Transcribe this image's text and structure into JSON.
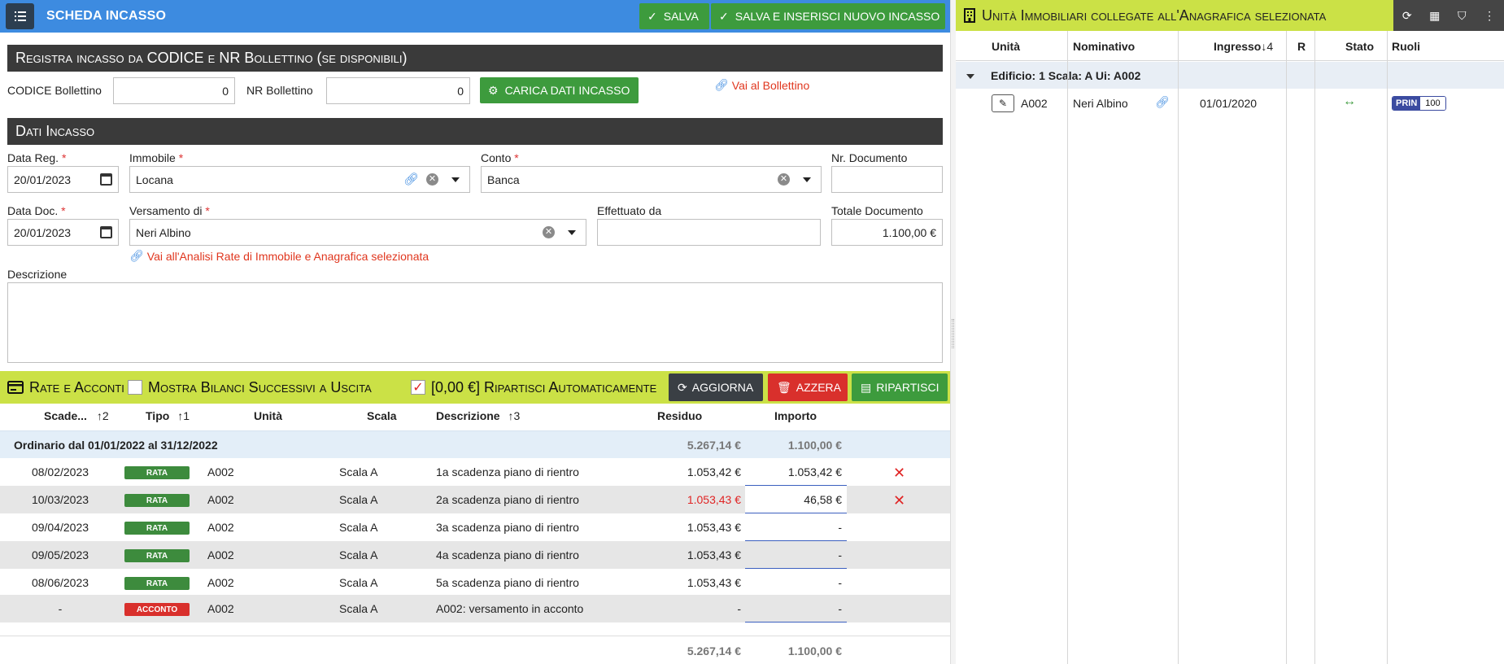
{
  "header": {
    "title": "SCHEDA INCASSO",
    "save_label": "SALVA",
    "save_new_label": "SALVA E INSERISCI NUOVO INCASSO"
  },
  "bollettino": {
    "section_title": "Registra incasso da CODICE e NR Bollettino (se disponibili)",
    "codice_label": "CODICE Bollettino",
    "codice_value": "0",
    "nr_label": "NR Bollettino",
    "nr_value": "0",
    "load_label": "CARICA DATI INCASSO",
    "link_label": "Vai al Bollettino"
  },
  "dati": {
    "section_title": "Dati Incasso",
    "data_reg_label": "Data Reg.",
    "data_reg_value": "20/01/2023",
    "immobile_label": "Immobile",
    "immobile_value": "Locana",
    "conto_label": "Conto",
    "conto_value": "Banca",
    "nr_doc_label": "Nr. Documento",
    "nr_doc_value": "",
    "data_doc_label": "Data Doc.",
    "data_doc_value": "20/01/2023",
    "versamento_label": "Versamento di",
    "versamento_value": "Neri Albino",
    "effettuato_label": "Effettuato da",
    "effettuato_value": "",
    "totale_label": "Totale Documento",
    "totale_value": "1.100,00 €",
    "analisi_link": "Vai all'Analisi Rate di Immobile e Anagrafica selezionata",
    "descrizione_label": "Descrizione",
    "descrizione_value": "",
    "required_mark": "*"
  },
  "rate": {
    "title": "Rate e Acconti",
    "mostra_label": "Mostra Bilanci Successivi a Uscita",
    "ripartisci_auto_label": "[0,00 €] Ripartisci Automaticamente",
    "aggiorna_label": "AGGIORNA",
    "azzera_label": "AZZERA",
    "ripartisci_label": "RIPARTISCI",
    "columns": {
      "scadenza": "Scade...",
      "scadenza_sort": "↑2",
      "tipo": "Tipo",
      "tipo_sort": "↑1",
      "unita": "Unità",
      "scala": "Scala",
      "descrizione": "Descrizione",
      "descrizione_sort": "↑3",
      "residuo": "Residuo",
      "importo": "Importo"
    },
    "group": {
      "label": "Ordinario dal 01/01/2022 al 31/12/2022",
      "residuo": "5.267,14 €",
      "importo": "1.100,00 €"
    },
    "rows": [
      {
        "scadenza": "08/02/2023",
        "tipo": "RATA",
        "unita": "A002",
        "scala": "Scala A",
        "descrizione": "1a scadenza piano di rientro",
        "residuo": "1.053,42 €",
        "importo": "1.053,42 €"
      },
      {
        "scadenza": "10/03/2023",
        "tipo": "RATA",
        "unita": "A002",
        "scala": "Scala A",
        "descrizione": "2a scadenza piano di rientro",
        "residuo": "1.053,43 €",
        "importo": "46,58 €"
      },
      {
        "scadenza": "09/04/2023",
        "tipo": "RATA",
        "unita": "A002",
        "scala": "Scala A",
        "descrizione": "3a scadenza piano di rientro",
        "residuo": "1.053,43 €",
        "importo": "-"
      },
      {
        "scadenza": "09/05/2023",
        "tipo": "RATA",
        "unita": "A002",
        "scala": "Scala A",
        "descrizione": "4a scadenza piano di rientro",
        "residuo": "1.053,43 €",
        "importo": "-"
      },
      {
        "scadenza": "08/06/2023",
        "tipo": "RATA",
        "unita": "A002",
        "scala": "Scala A",
        "descrizione": "5a scadenza piano di rientro",
        "residuo": "1.053,43 €",
        "importo": "-"
      },
      {
        "scadenza": "-",
        "tipo": "ACCONTO",
        "unita": "A002",
        "scala": "Scala A",
        "descrizione": "A002: versamento in acconto",
        "residuo": "-",
        "importo": "-"
      }
    ],
    "totals": {
      "residuo": "5.267,14 €",
      "importo": "1.100,00 €"
    }
  },
  "unita": {
    "title": "Unità Immobiliari collegate all'Anagrafica selezionata",
    "columns": {
      "unita": "Unità",
      "nominativo": "Nominativo",
      "ingresso": "Ingresso",
      "ingresso_sort": "↓4",
      "r": "R",
      "stato": "Stato",
      "ruoli": "Ruoli"
    },
    "group_label": "Edificio: 1 Scala: A Ui: A002",
    "rows": [
      {
        "unita": "A002",
        "nominativo": "Neri Albino",
        "ingresso": "01/01/2020",
        "ruolo": "PRIN",
        "ruolo_value": "100"
      }
    ]
  },
  "colors": {
    "accent_blue": "#3d8be0",
    "save_green": "#3d9b3d",
    "lime": "#cbe146",
    "dark": "#3a3a3a",
    "link_red": "#e0361e",
    "rata_green": "#3d8b3d",
    "acconto_red": "#d9302c",
    "azzera_red": "#d9302c",
    "aggiorna_dark": "#3a3f44",
    "prin_blue": "#3b4ba0"
  }
}
